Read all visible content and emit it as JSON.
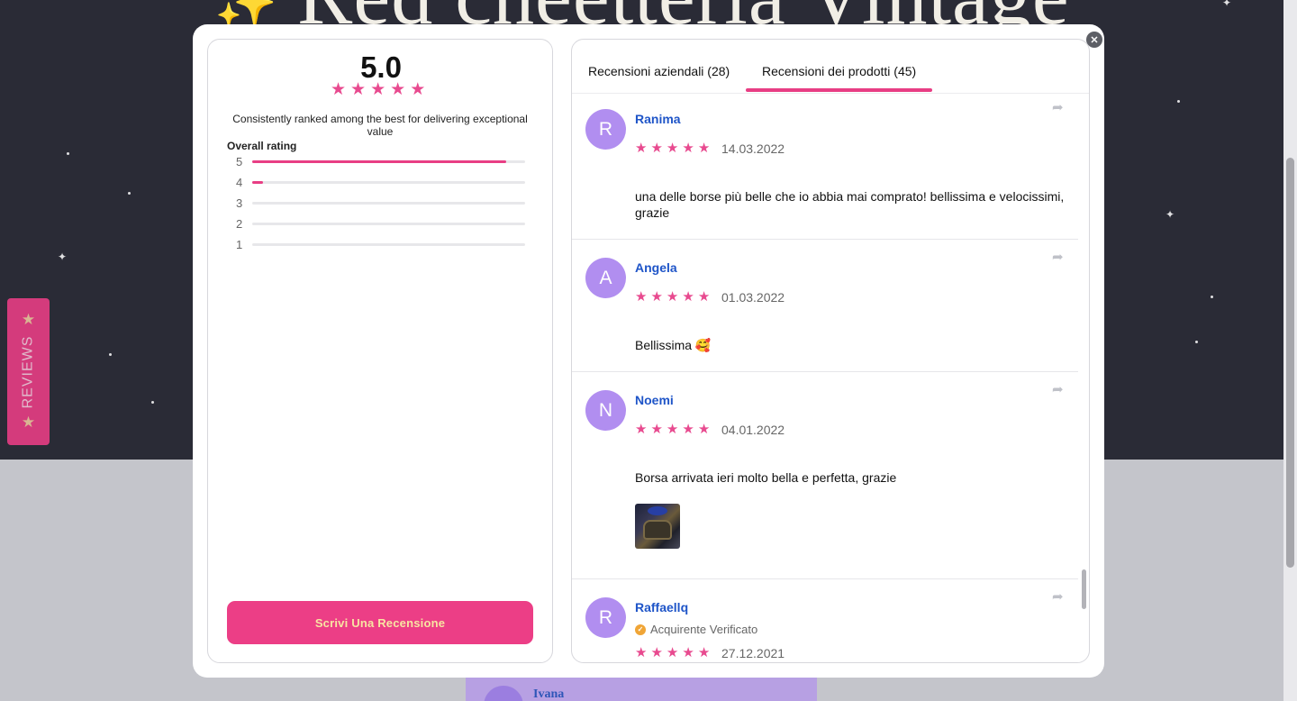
{
  "background": {
    "title": "Red cheetteria Vintage",
    "sparkle": "✨",
    "peek_name": "Ivana"
  },
  "side_tab": {
    "label": "REVIEWS",
    "star": "★"
  },
  "modal": {
    "close_glyph": "✕",
    "summary": {
      "score": "5.0",
      "stars": [
        "★",
        "★",
        "★",
        "★",
        "★"
      ],
      "tagline": "Consistently ranked among the best for delivering exceptional value",
      "overall_label": "Overall rating",
      "distribution": [
        {
          "label": "5",
          "fraction": 0.93
        },
        {
          "label": "4",
          "fraction": 0.04
        },
        {
          "label": "3",
          "fraction": 0
        },
        {
          "label": "2",
          "fraction": 0
        },
        {
          "label": "1",
          "fraction": 0
        }
      ],
      "write_button": "Scrivi Una Recensione"
    },
    "tabs": [
      {
        "label": "Recensioni aziendali (28)",
        "active": false
      },
      {
        "label": "Recensioni dei prodotti (45)",
        "active": true
      }
    ],
    "reviews": [
      {
        "initial": "R",
        "name": "Ranima",
        "rating": 5,
        "date": "14.03.2022",
        "text": "una delle borse più belle che io abbia mai comprato! bellissima e velocissimi, grazie"
      },
      {
        "initial": "A",
        "name": "Angela",
        "rating": 5,
        "date": "01.03.2022",
        "text": "Bellissima 🥰"
      },
      {
        "initial": "N",
        "name": "Noemi",
        "rating": 5,
        "date": "04.01.2022",
        "text": "Borsa arrivata ieri molto bella e perfetta, grazie"
      },
      {
        "initial": "R",
        "name": "Raffaellq",
        "verified": "Acquirente Verificato",
        "check": "✓",
        "rating": 5,
        "date": "27.12.2021"
      }
    ],
    "share_glyph": "➦",
    "star_glyph": "★"
  },
  "colors": {
    "accent_pink": "#ec3e86",
    "star_pink": "#e84a8f",
    "name_blue": "#1f55c8",
    "avatar_purple": "#b18ef0",
    "verified_orange": "#f0a536"
  }
}
